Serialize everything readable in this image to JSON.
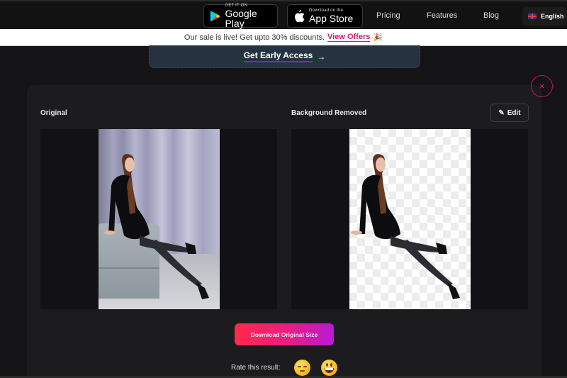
{
  "topnav": {
    "google_play": {
      "small": "GET IT ON",
      "big": "Google Play"
    },
    "app_store": {
      "small": "Download on the",
      "big": "App Store"
    },
    "links": [
      "Pricing",
      "Features",
      "Blog"
    ],
    "language": "English"
  },
  "banner": {
    "text": "Our sale is live! Get upto 30% discounts.",
    "link": "View Offers",
    "emoji": "🎉"
  },
  "early_access": {
    "label": "Get Early Access",
    "arrow": "→"
  },
  "close": {
    "glyph": "×"
  },
  "result": {
    "original_label": "Original",
    "removed_label": "Background Removed",
    "edit_label": "Edit",
    "edit_icon": "✎",
    "download_label": "Download Original Size",
    "rate_label": "Rate this result:"
  },
  "colors": {
    "accent_pink": "#d6186b",
    "close_red": "#c0184f",
    "download_gradient_start": "#ff2a4a",
    "download_gradient_end": "#b81ad8"
  }
}
